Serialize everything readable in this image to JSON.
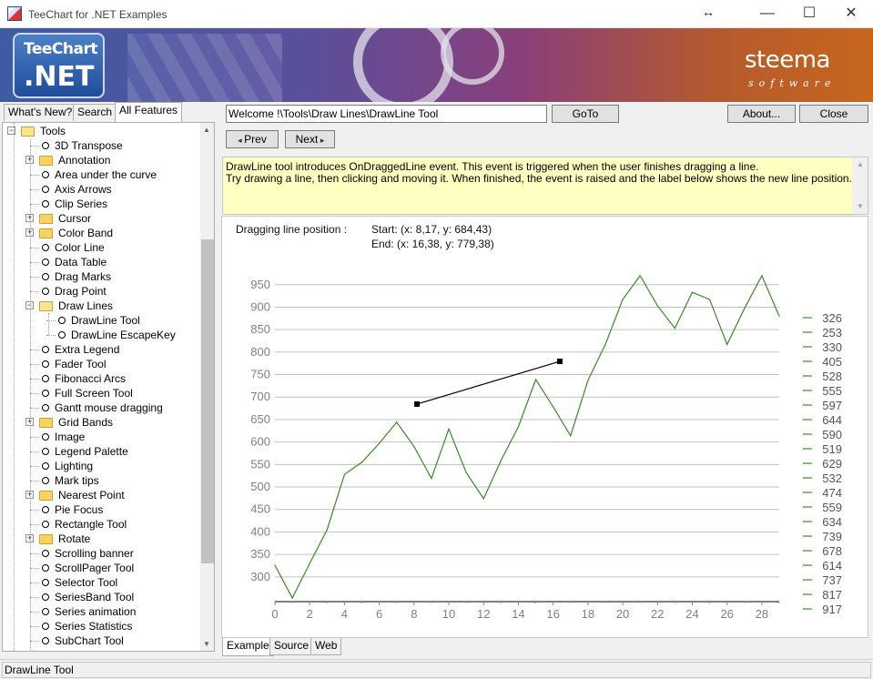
{
  "window": {
    "title": "TeeChart for .NET Examples",
    "resize_glyph": "↔",
    "minimize": "—",
    "maximize": "☐",
    "close": "✕"
  },
  "banner": {
    "logo_top": "TeeChart",
    "logo_bottom": ".NET",
    "brand": "steema",
    "brand_sub": "software"
  },
  "left_tabs": [
    {
      "label": "What's New?",
      "active": false
    },
    {
      "label": "Search",
      "active": false
    },
    {
      "label": "All Features",
      "active": true
    }
  ],
  "tree": {
    "items": [
      {
        "label": "Tools",
        "type": "folder-open",
        "level": 0,
        "expander": "minus"
      },
      {
        "label": "3D Transpose",
        "type": "leaf",
        "level": 1
      },
      {
        "label": "Annotation",
        "type": "folder",
        "level": 1,
        "expander": "plus"
      },
      {
        "label": "Area under the curve",
        "type": "leaf",
        "level": 1
      },
      {
        "label": "Axis Arrows",
        "type": "leaf",
        "level": 1
      },
      {
        "label": "Clip Series",
        "type": "leaf",
        "level": 1
      },
      {
        "label": "Cursor",
        "type": "folder",
        "level": 1,
        "expander": "plus"
      },
      {
        "label": "Color Band",
        "type": "folder",
        "level": 1,
        "expander": "plus"
      },
      {
        "label": "Color Line",
        "type": "leaf",
        "level": 1
      },
      {
        "label": "Data Table",
        "type": "leaf",
        "level": 1
      },
      {
        "label": "Drag Marks",
        "type": "leaf",
        "level": 1
      },
      {
        "label": "Drag Point",
        "type": "leaf",
        "level": 1
      },
      {
        "label": "Draw Lines",
        "type": "folder-open",
        "level": 1,
        "expander": "minus"
      },
      {
        "label": "DrawLine Tool",
        "type": "leaf",
        "level": 2,
        "selected": true
      },
      {
        "label": "DrawLine EscapeKey",
        "type": "leaf",
        "level": 2
      },
      {
        "label": "Extra Legend",
        "type": "leaf",
        "level": 1
      },
      {
        "label": "Fader Tool",
        "type": "leaf",
        "level": 1
      },
      {
        "label": "Fibonacci Arcs",
        "type": "leaf",
        "level": 1
      },
      {
        "label": "Full Screen Tool",
        "type": "leaf",
        "level": 1
      },
      {
        "label": "Gantt mouse dragging",
        "type": "leaf",
        "level": 1
      },
      {
        "label": "Grid Bands",
        "type": "folder",
        "level": 1,
        "expander": "plus"
      },
      {
        "label": "Image",
        "type": "leaf",
        "level": 1
      },
      {
        "label": "Legend Palette",
        "type": "leaf",
        "level": 1
      },
      {
        "label": "Lighting",
        "type": "leaf",
        "level": 1
      },
      {
        "label": "Mark tips",
        "type": "leaf",
        "level": 1
      },
      {
        "label": "Nearest Point",
        "type": "folder",
        "level": 1,
        "expander": "plus"
      },
      {
        "label": "Pie Focus",
        "type": "leaf",
        "level": 1
      },
      {
        "label": "Rectangle Tool",
        "type": "leaf",
        "level": 1
      },
      {
        "label": "Rotate",
        "type": "folder",
        "level": 1,
        "expander": "plus"
      },
      {
        "label": "Scrolling banner",
        "type": "leaf",
        "level": 1
      },
      {
        "label": "ScrollPager Tool",
        "type": "leaf",
        "level": 1
      },
      {
        "label": "Selector Tool",
        "type": "leaf",
        "level": 1
      },
      {
        "label": "SeriesBand Tool",
        "type": "leaf",
        "level": 1
      },
      {
        "label": "Series animation",
        "type": "leaf",
        "level": 1
      },
      {
        "label": "Series Statistics",
        "type": "leaf",
        "level": 1
      },
      {
        "label": "SubChart Tool",
        "type": "leaf",
        "level": 1
      }
    ]
  },
  "toolbar": {
    "path_value": "Welcome !\\Tools\\Draw Lines\\DrawLine Tool",
    "goto_label": "GoTo",
    "about_label": "About...",
    "close_label": "Close",
    "prev_label": "Prev",
    "next_label": "Next"
  },
  "description": {
    "line1": "DrawLine tool introduces OnDraggedLine event. This event is triggered when the user finishes dragging a line.",
    "line2": "Try drawing a line, then clicking and moving it. When finished, the event is raised and the label below shows the new line position."
  },
  "drag_info": {
    "label": "Dragging line position :",
    "start": "Start: (x: 8,17, y: 684,43)",
    "end": "End: (x: 16,38, y: 779,38)"
  },
  "chart_data": {
    "type": "line",
    "title": "",
    "xlabel": "",
    "ylabel": "",
    "xlim": [
      0,
      29
    ],
    "ylim": [
      245,
      990
    ],
    "x_ticks": [
      0,
      2,
      4,
      6,
      8,
      10,
      12,
      14,
      16,
      18,
      20,
      22,
      24,
      26,
      28
    ],
    "y_ticks": [
      300,
      350,
      400,
      450,
      500,
      550,
      600,
      650,
      700,
      750,
      800,
      850,
      900,
      950
    ],
    "grid": true,
    "line_color": "#3a8a2a",
    "series": [
      {
        "x": [
          0,
          1,
          2,
          3,
          4,
          5,
          6,
          7,
          8,
          9,
          10,
          11,
          12,
          13,
          14,
          15,
          16,
          17,
          18,
          19,
          20,
          21,
          22,
          23,
          24,
          25,
          26,
          27,
          28,
          29
        ],
        "values": [
          326,
          253,
          330,
          405,
          528,
          555,
          597,
          644,
          590,
          519,
          629,
          532,
          474,
          559,
          634,
          739,
          678,
          614,
          737,
          817,
          917,
          970,
          903,
          853,
          933,
          917,
          817,
          897,
          970,
          880
        ]
      }
    ],
    "legend": {
      "position": "right",
      "entries": [
        "326",
        "253",
        "330",
        "405",
        "528",
        "555",
        "597",
        "644",
        "590",
        "519",
        "629",
        "532",
        "474",
        "559",
        "634",
        "739",
        "678",
        "614",
        "737",
        "817",
        "917"
      ]
    },
    "drawn_line": {
      "start": [
        8.17,
        684.43
      ],
      "end": [
        16.38,
        779.38
      ],
      "color": "#000000"
    }
  },
  "bottom_tabs": [
    {
      "label": "Example",
      "active": true
    },
    {
      "label": "Source",
      "active": false
    },
    {
      "label": "Web",
      "active": false
    }
  ],
  "status": {
    "text": "DrawLine Tool"
  }
}
